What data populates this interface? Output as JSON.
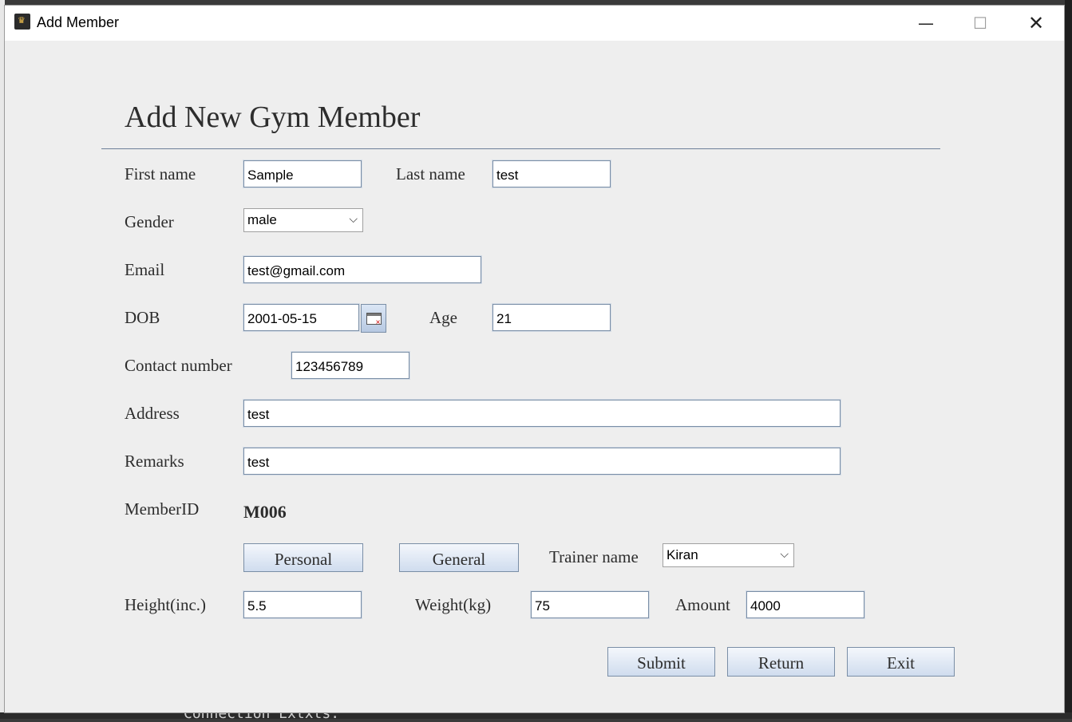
{
  "window": {
    "title": "Add Member"
  },
  "background": {
    "terminal_text": "Connection  Extxts:"
  },
  "form": {
    "heading": "Add New Gym Member",
    "labels": {
      "first_name": "First name",
      "last_name": "Last name",
      "gender": "Gender",
      "email": "Email",
      "dob": "DOB",
      "age": "Age",
      "contact": "Contact number",
      "address": "Address",
      "remarks": "Remarks",
      "member_id": "MemberID",
      "trainer": "Trainer name",
      "height": "Height(inc.)",
      "weight": "Weight(kg)",
      "amount": "Amount"
    },
    "values": {
      "first_name": "Sample",
      "last_name": "test",
      "gender": "male",
      "email": "test@gmail.com",
      "dob": "2001-05-15",
      "age": "21",
      "contact": "123456789",
      "address": "test",
      "remarks": "test",
      "member_id": "M006",
      "trainer": "Kiran",
      "height": "5.5",
      "weight": "75",
      "amount": "4000"
    },
    "buttons": {
      "personal": "Personal",
      "general": "General",
      "submit": "Submit",
      "return": "Return",
      "exit": "Exit"
    },
    "icons": {
      "calendar": "calendar-icon",
      "dropdown": "chevron-down-icon"
    }
  }
}
